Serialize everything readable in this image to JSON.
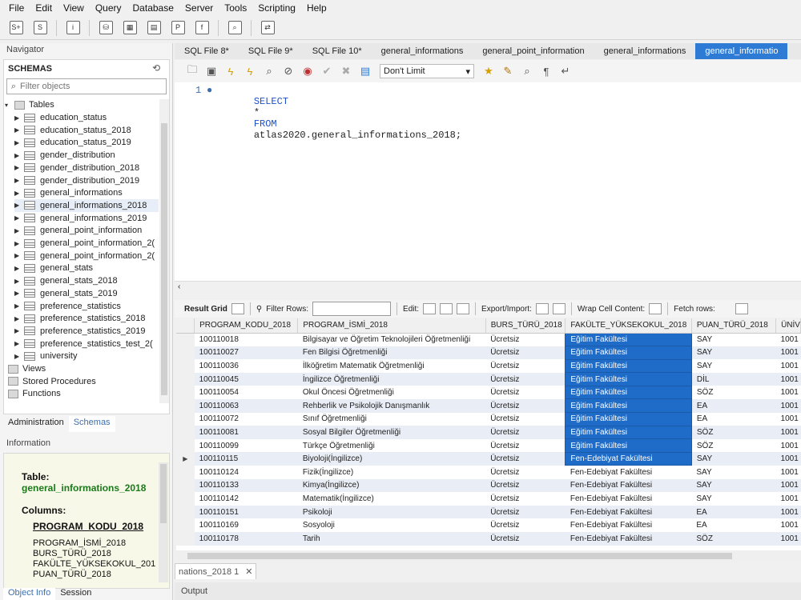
{
  "menu": [
    "File",
    "Edit",
    "View",
    "Query",
    "Database",
    "Server",
    "Tools",
    "Scripting",
    "Help"
  ],
  "navigator": {
    "header": "Navigator",
    "schemas_title": "SCHEMAS",
    "filter_placeholder": "Filter objects",
    "tables_label": "Tables",
    "tables": [
      "education_status",
      "education_status_2018",
      "education_status_2019",
      "gender_distribution",
      "gender_distribution_2018",
      "gender_distribution_2019",
      "general_informations",
      "general_informations_2018",
      "general_informations_2019",
      "general_point_information",
      "general_point_information_2(",
      "general_point_information_2(",
      "general_stats",
      "general_stats_2018",
      "general_stats_2019",
      "preference_statistics",
      "preference_statistics_2018",
      "preference_statistics_2019",
      "preference_statistics_test_2(",
      "university"
    ],
    "other_nodes": [
      "Views",
      "Stored Procedures",
      "Functions"
    ],
    "tabs": [
      "Administration",
      "Schemas"
    ]
  },
  "information": {
    "header": "Information",
    "table_label": "Table:",
    "table_name": "general_informations_2018",
    "columns_label": "Columns:",
    "columns": [
      "PROGRAM_KODU_2018",
      "PROGRAM_İSMİ_2018",
      "BURS_TÜRÜ_2018",
      "FAKÜLTE_YÜKSEKOKUL_201",
      "PUAN_TÜRÜ_2018"
    ]
  },
  "bottom_tabs": [
    "Object Info",
    "Session"
  ],
  "editor": {
    "tabs": [
      "SQL File 8*",
      "SQL File 9*",
      "SQL File 10*",
      "general_informations",
      "general_point_information",
      "general_informations",
      "general_informatio"
    ],
    "limit": "Don't Limit",
    "line_number": "1",
    "sql": {
      "kw1": "SELECT",
      "star": "*",
      "kw2": "FROM",
      "target": "atlas2020.general_informations_2018;"
    }
  },
  "result_toolbar": {
    "result_grid": "Result Grid",
    "filter_rows": "Filter Rows:",
    "edit": "Edit:",
    "export_import": "Export/Import:",
    "wrap": "Wrap Cell Content:",
    "fetch": "Fetch rows:"
  },
  "grid": {
    "columns": [
      "PROGRAM_KODU_2018",
      "PROGRAM_İSMİ_2018",
      "BURS_TÜRÜ_2018",
      "FAKÜLTE_YÜKSEKOKUL_2018",
      "PUAN_TÜRÜ_2018",
      "ÜNİV"
    ],
    "rows": [
      [
        "100110018",
        "Bilgisayar ve Öğretim Teknolojileri Öğretmenliği",
        "Ücretsiz",
        "Eğitim Fakültesi",
        "SAY",
        "1001"
      ],
      [
        "100110027",
        "Fen Bilgisi Öğretmenliği",
        "Ücretsiz",
        "Eğitim Fakültesi",
        "SAY",
        "1001"
      ],
      [
        "100110036",
        "İlköğretim Matematik Öğretmenliği",
        "Ücretsiz",
        "Eğitim Fakültesi",
        "SAY",
        "1001"
      ],
      [
        "100110045",
        "İngilizce Öğretmenliği",
        "Ücretsiz",
        "Eğitim Fakültesi",
        "DİL",
        "1001"
      ],
      [
        "100110054",
        "Okul Öncesi Öğretmenliği",
        "Ücretsiz",
        "Eğitim Fakültesi",
        "SÖZ",
        "1001"
      ],
      [
        "100110063",
        "Rehberlik ve Psikolojik Danışmanlık",
        "Ücretsiz",
        "Eğitim Fakültesi",
        "EA",
        "1001"
      ],
      [
        "100110072",
        "Sınıf Öğretmenliği",
        "Ücretsiz",
        "Eğitim Fakültesi",
        "EA",
        "1001"
      ],
      [
        "100110081",
        "Sosyal Bilgiler Öğretmenliği",
        "Ücretsiz",
        "Eğitim Fakültesi",
        "SÖZ",
        "1001"
      ],
      [
        "100110099",
        "Türkçe Öğretmenliği",
        "Ücretsiz",
        "Eğitim Fakültesi",
        "SÖZ",
        "1001"
      ],
      [
        "100110115",
        "Biyoloji(İngilizce)",
        "Ücretsiz",
        "Fen-Edebiyat Fakültesi",
        "SAY",
        "1001"
      ],
      [
        "100110124",
        "Fizik(İngilizce)",
        "Ücretsiz",
        "Fen-Edebiyat Fakültesi",
        "SAY",
        "1001"
      ],
      [
        "100110133",
        "Kimya(İngilizce)",
        "Ücretsiz",
        "Fen-Edebiyat Fakültesi",
        "SAY",
        "1001"
      ],
      [
        "100110142",
        "Matematik(İngilizce)",
        "Ücretsiz",
        "Fen-Edebiyat Fakültesi",
        "SAY",
        "1001"
      ],
      [
        "100110151",
        "Psikoloji",
        "Ücretsiz",
        "Fen-Edebiyat Fakültesi",
        "EA",
        "1001"
      ],
      [
        "100110169",
        "Sosyoloji",
        "Ücretsiz",
        "Fen-Edebiyat Fakültesi",
        "EA",
        "1001"
      ],
      [
        "100110178",
        "Tarih",
        "Ücretsiz",
        "Fen-Edebiyat Fakültesi",
        "SÖZ",
        "1001"
      ]
    ],
    "selected_rows_in_faculty_column": 10,
    "current_row_marker": "▶"
  },
  "result_tab": "nations_2018 1",
  "output_label": "Output",
  "colors": {
    "accent": "#2e7bd6",
    "selection": "#1f6bc8",
    "info_table": "#1a7a1a"
  }
}
